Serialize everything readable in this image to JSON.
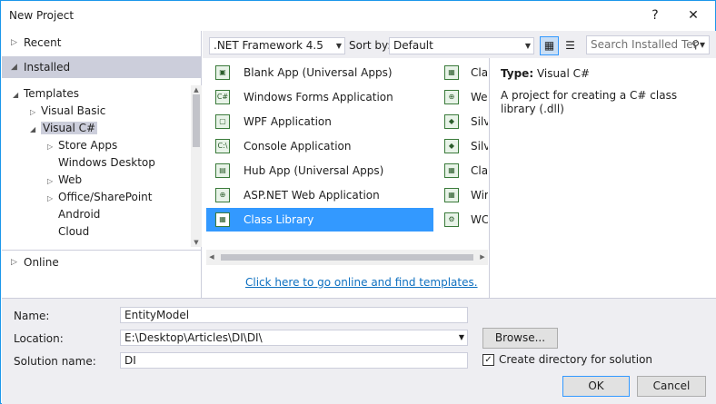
{
  "window": {
    "title": "New Project",
    "help_icon": "question-mark",
    "close_icon": "close-x"
  },
  "nav": {
    "recent": "Recent",
    "installed": "Installed",
    "online": "Online",
    "tree": [
      {
        "label": "Templates",
        "expander": "expanded",
        "level": 0
      },
      {
        "label": "Visual Basic",
        "expander": "collapsed",
        "level": 1
      },
      {
        "label": "Visual C#",
        "expander": "expanded",
        "level": 1,
        "selected": true
      },
      {
        "label": "Store Apps",
        "expander": "collapsed",
        "level": 2
      },
      {
        "label": "Windows Desktop",
        "expander": "none",
        "level": 2
      },
      {
        "label": "Web",
        "expander": "collapsed",
        "level": 2
      },
      {
        "label": "Office/SharePoint",
        "expander": "collapsed",
        "level": 2
      },
      {
        "label": "Android",
        "expander": "none",
        "level": 2
      },
      {
        "label": "Cloud",
        "expander": "none",
        "level": 2
      }
    ]
  },
  "toolbar": {
    "framework": ".NET Framework 4.5",
    "sort_label": "Sort by:",
    "sort_value": "Default",
    "search_placeholder": "Search Installed Ter"
  },
  "templates": [
    {
      "name": "Blank App (Universal Apps)"
    },
    {
      "name": "Windows Forms Application"
    },
    {
      "name": "WPF Application"
    },
    {
      "name": "Console Application"
    },
    {
      "name": "Hub App (Universal Apps)"
    },
    {
      "name": "ASP.NET Web Application"
    },
    {
      "name": "Class Library",
      "selected": true
    }
  ],
  "templates_col2": [
    "Clas",
    "Web",
    "Silv",
    "Silv",
    "Clas",
    "Wir",
    "WC"
  ],
  "online_link": "Click here to go online and find templates.",
  "description": {
    "type_label": "Type:",
    "type_value": "Visual C#",
    "text": "A project for creating a C# class library (.dll)"
  },
  "form": {
    "name_label": "Name:",
    "name_value": "EntityModel",
    "location_label": "Location:",
    "location_value": "E:\\Desktop\\Articles\\DI\\DI\\",
    "solution_label": "Solution name:",
    "solution_value": "DI",
    "browse": "Browse...",
    "create_dir": "Create directory for solution",
    "create_dir_checked": true,
    "ok": "OK",
    "cancel": "Cancel"
  },
  "colors": {
    "accent": "#3399ff",
    "link": "#0e70c0",
    "panel": "#eeeef2",
    "selection_gray": "#cccedb"
  }
}
